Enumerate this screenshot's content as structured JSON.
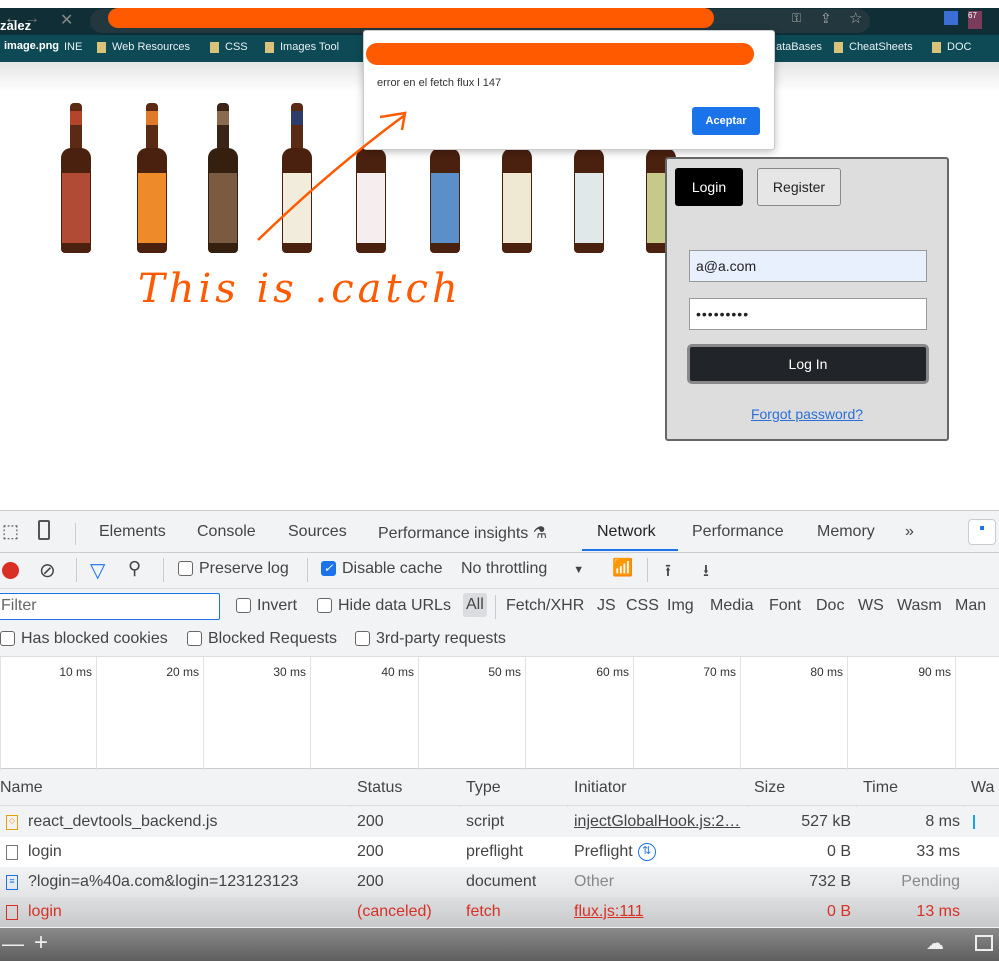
{
  "browser": {
    "window_title_fragment": "zalez",
    "tab_label": "image.png",
    "bookmarks": [
      "INE",
      "Web Resources",
      "CSS",
      "Images Tool",
      "ataBases",
      "CheatSheets",
      "DOC"
    ],
    "extension_badge": "67"
  },
  "alert": {
    "message": "error en el fetch flux l 147",
    "ok_label": "Aceptar"
  },
  "annotation": {
    "handwritten_text": "This is .catch",
    "color": "#ff5a00"
  },
  "login_panel": {
    "tab_login": "Login",
    "tab_register": "Register",
    "email_value": "a@a.com",
    "password_value": "•••••••••",
    "submit_label": "Log In",
    "forgot_link": "Forgot password?"
  },
  "devtools": {
    "tabs": [
      "Elements",
      "Console",
      "Sources",
      "Performance insights",
      "Network",
      "Performance",
      "Memory"
    ],
    "active_tab": "Network",
    "more_tabs": "»",
    "toolbar": {
      "preserve_log": "Preserve log",
      "preserve_log_checked": false,
      "disable_cache": "Disable cache",
      "disable_cache_checked": true,
      "throttling": "No throttling"
    },
    "filter": {
      "placeholder": "Filter",
      "invert": "Invert",
      "hide_data_urls": "Hide data URLs",
      "types": [
        "All",
        "Fetch/XHR",
        "JS",
        "CSS",
        "Img",
        "Media",
        "Font",
        "Doc",
        "WS",
        "Wasm",
        "Man"
      ],
      "active_type": "All"
    },
    "checkboxes": [
      "Has blocked cookies",
      "Blocked Requests",
      "3rd-party requests"
    ],
    "timeline_ticks": [
      "10 ms",
      "20 ms",
      "30 ms",
      "40 ms",
      "50 ms",
      "60 ms",
      "70 ms",
      "80 ms",
      "90 ms"
    ],
    "columns": [
      "Name",
      "Status",
      "Type",
      "Initiator",
      "Size",
      "Time",
      "Wa"
    ],
    "rows": [
      {
        "name": "react_devtools_backend.js",
        "status": "200",
        "type": "script",
        "initiator": "injectGlobalHook.js:2…",
        "size": "527 kB",
        "time": "8 ms"
      },
      {
        "name": "login",
        "status": "200",
        "type": "preflight",
        "initiator": "Preflight",
        "size": "0 B",
        "time": "33 ms"
      },
      {
        "name": "?login=a%40a.com&login=123123123",
        "status": "200",
        "type": "document",
        "initiator": "Other",
        "size": "732 B",
        "time": "Pending"
      },
      {
        "name": "login",
        "status": "(canceled)",
        "type": "fetch",
        "initiator": "flux.js:111",
        "size": "0 B",
        "time": "13 ms"
      }
    ],
    "accent": "#1a73e8",
    "error_color": "#d93025"
  }
}
